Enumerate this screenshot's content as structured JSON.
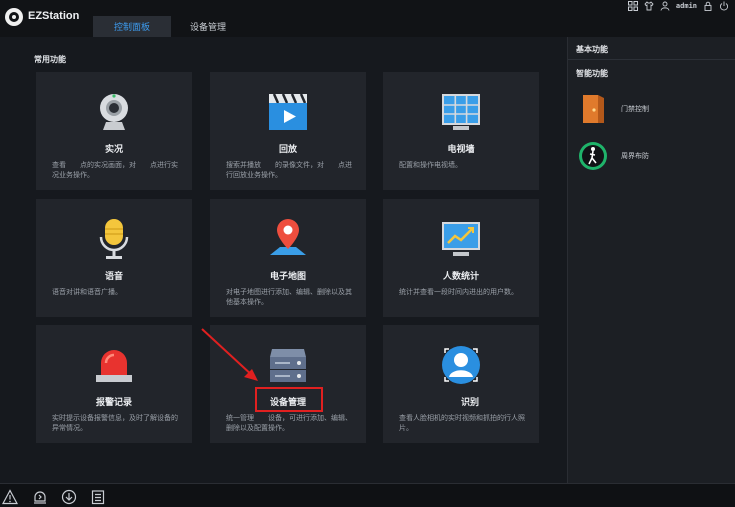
{
  "app": {
    "name": "EZStation"
  },
  "tabs": [
    {
      "label": "控制面板",
      "active": true
    },
    {
      "label": "设备管理",
      "active": false
    }
  ],
  "user": {
    "name": "admin"
  },
  "main": {
    "section_title": "常用功能",
    "cards": [
      {
        "title": "实况",
        "desc": "查看　　点的实况画面，对　　点进行实况业务操作。",
        "icon": "camera-icon"
      },
      {
        "title": "回放",
        "desc": "搜索并播放　　的录像文件，对　　点进行回放业务操作。",
        "icon": "playback-icon"
      },
      {
        "title": "电视墙",
        "desc": "配置和操作电视墙。",
        "icon": "tv-wall-icon"
      },
      {
        "title": "语音",
        "desc": "语音对讲和语音广播。",
        "icon": "microphone-icon"
      },
      {
        "title": "电子地图",
        "desc": "对电子地图进行添加、编辑、删除以及其他基本操作。",
        "icon": "map-pin-icon"
      },
      {
        "title": "人数统计",
        "desc": "统计并查看一段时间内进出的用户数。",
        "icon": "people-count-icon"
      },
      {
        "title": "报警记录",
        "desc": "实时提示设备报警信息，及时了解设备的异常情况。",
        "icon": "alarm-light-icon"
      },
      {
        "title": "设备管理",
        "desc": "统一管理　　设备，可进行添加、编辑、删除以及配置操作。",
        "icon": "server-icon"
      },
      {
        "title": "　　识别",
        "desc": "查看人脸相机的实时视频和抓拍的行人照片。",
        "icon": "face-recognition-icon"
      }
    ]
  },
  "right_panel": {
    "basic_title": "基本功能",
    "smart_title": "智能功能",
    "items": [
      {
        "label": "门禁控制",
        "icon": "door-icon"
      },
      {
        "label": "周界布防",
        "icon": "perimeter-icon"
      }
    ]
  },
  "bottom_bar": {
    "icons": [
      "warning-icon",
      "alert-bell-icon",
      "download-icon",
      "task-list-icon"
    ]
  },
  "colors": {
    "accent": "#3d9cf0",
    "highlight": "#e02020",
    "background": "#16191e",
    "card": "#22252b"
  }
}
